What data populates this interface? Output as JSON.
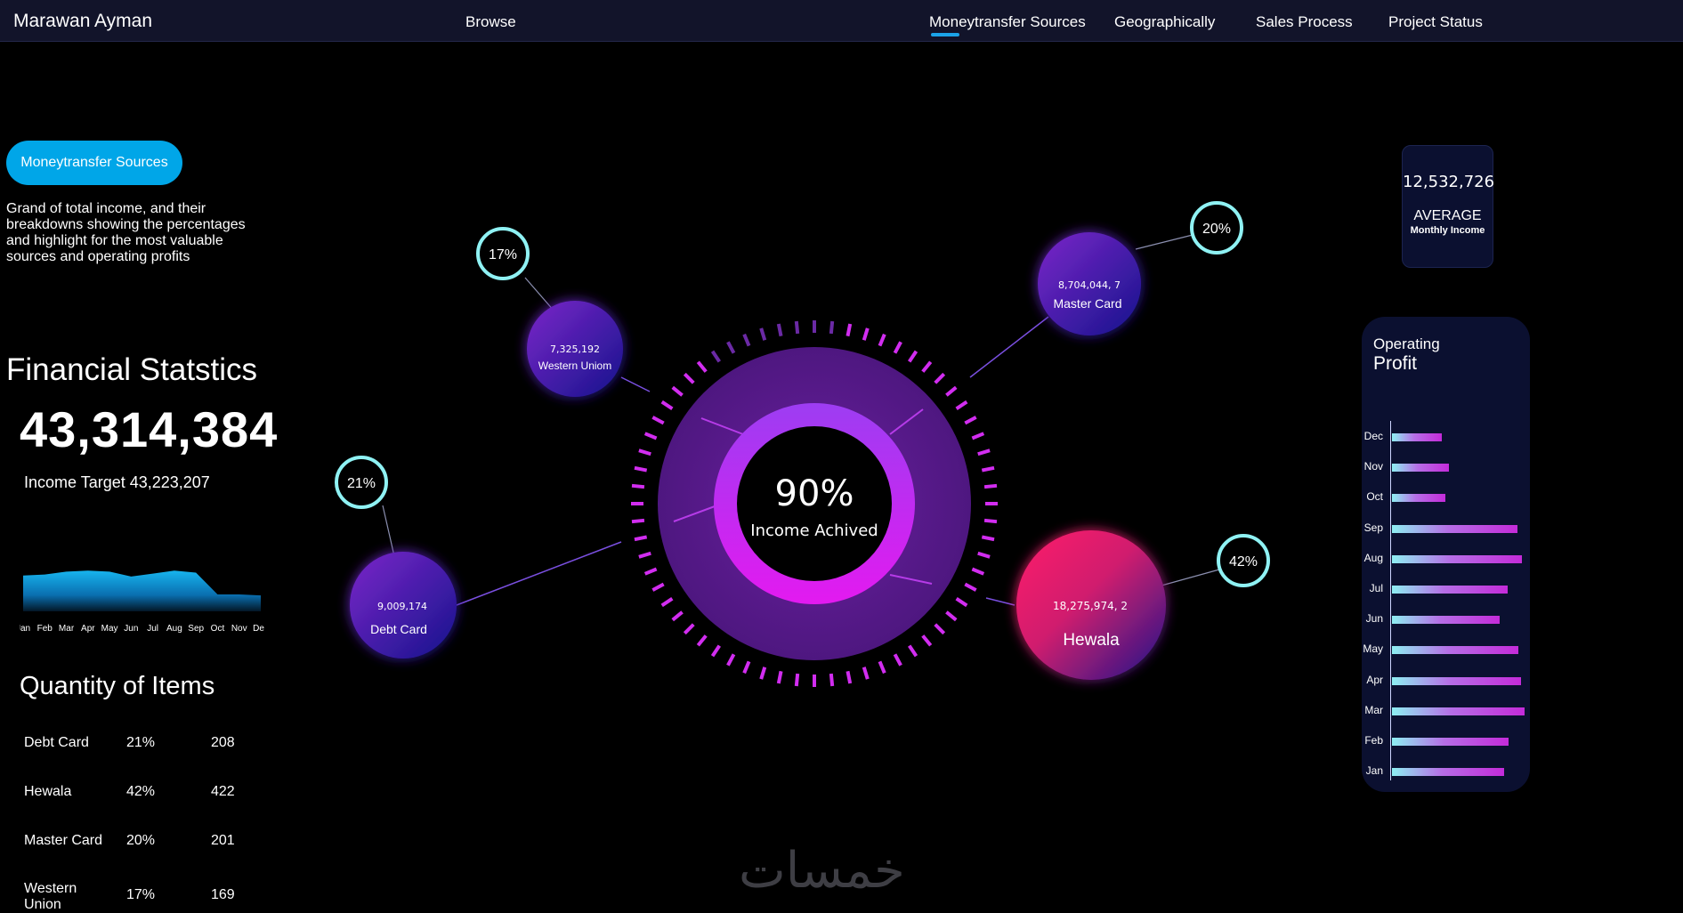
{
  "header": {
    "brand": "Marawan Ayman",
    "browse": "Browse",
    "tabs": [
      {
        "label": "Moneytransfer Sources",
        "active": true
      },
      {
        "label": "Geographically"
      },
      {
        "label": "Sales Process"
      },
      {
        "label": "Project Status"
      }
    ]
  },
  "left": {
    "pill_label": "Moneytransfer Sources",
    "description": "Grand of total income, and their breakdowns showing the  percentages and highlight for the most valuable sources and operating profits",
    "financial_title": "Financial Statstics",
    "financial_value": "43,314,384",
    "income_target": "Income Target 43,223,207",
    "quantity_title": "Quantity of Items",
    "quantity_rows": [
      {
        "name": "Debt Card",
        "pct": "21%",
        "qty": "208"
      },
      {
        "name": "Hewala",
        "pct": "42%",
        "qty": "422"
      },
      {
        "name": "Master Card",
        "pct": "20%",
        "qty": "201"
      },
      {
        "name": "Western Union",
        "pct": "17%",
        "qty": "169"
      }
    ]
  },
  "center": {
    "gauge_percent": "90%",
    "gauge_label": "Income Achived",
    "gauge_value": 90,
    "bubbles": [
      {
        "key": "western",
        "value": "7,325,192",
        "name": "Western Uniom",
        "pct": "17%"
      },
      {
        "key": "master",
        "value": "8,704,044, 7",
        "name": "Master Card",
        "pct": "20%"
      },
      {
        "key": "debt",
        "value": "9,009,174",
        "name": "Debt Card",
        "pct": "21%"
      },
      {
        "key": "hewala",
        "value": "18,275,974, 2",
        "name": "Hewala",
        "pct": "42%"
      }
    ]
  },
  "right": {
    "average_value": "12,532,726",
    "average_label": "AVERAGE",
    "average_sub": "Monthly Income",
    "op_title_1": "Operating",
    "op_title_2": "Profit"
  },
  "watermark": "خمسات",
  "colors": {
    "accent_blue": "#00a6e8",
    "ring_magenta": "#d22df0",
    "bubble_ring": "#8ff2f4",
    "panel_bg": "#0b1030"
  },
  "chart_data": [
    {
      "type": "area",
      "categories": [
        "Jan",
        "Feb",
        "Mar",
        "Apr",
        "May",
        "Jun",
        "Jul",
        "Aug",
        "Sep",
        "Oct",
        "Nov",
        "Dec"
      ],
      "values": [
        3.6,
        3.7,
        4.0,
        4.1,
        4.0,
        3.5,
        3.8,
        4.1,
        3.9,
        1.7,
        1.7,
        1.6
      ],
      "ylim": [
        0,
        6
      ],
      "grid": false
    },
    {
      "type": "bar",
      "orientation": "horizontal",
      "categories": [
        "Dec",
        "Nov",
        "Oct",
        "Sep",
        "Aug",
        "Jul",
        "Jun",
        "May",
        "Apr",
        "Mar",
        "Feb",
        "Jan"
      ],
      "values": [
        47,
        54,
        51,
        119,
        123,
        110,
        102,
        120,
        122,
        126,
        111,
        106
      ],
      "ylim": [
        0,
        130
      ],
      "grid": false
    }
  ]
}
